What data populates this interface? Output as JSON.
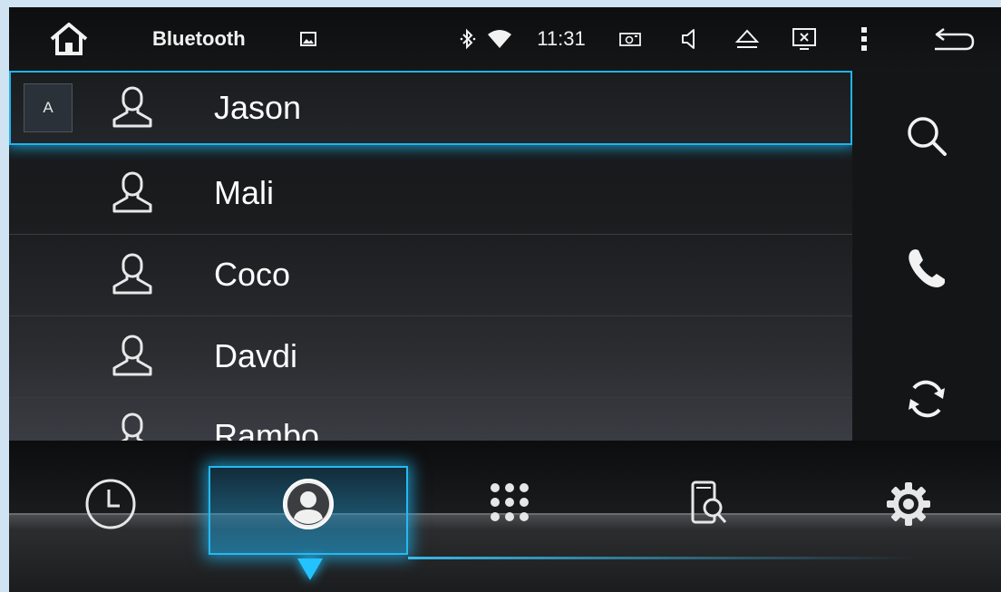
{
  "status_bar": {
    "title": "Bluetooth",
    "time": "11:31",
    "icons": [
      "home-icon",
      "image-icon",
      "bluetooth-icon",
      "wifi-icon",
      "screenshot-icon",
      "volume-icon",
      "eject-icon",
      "close-window-icon",
      "more-icon",
      "back-icon"
    ]
  },
  "contacts": {
    "index_letter": "A",
    "items": [
      {
        "name": "Jason",
        "selected": true
      },
      {
        "name": "Mali"
      },
      {
        "name": "Coco"
      },
      {
        "name": "Davdi"
      },
      {
        "name": "Rambo"
      }
    ]
  },
  "side_actions": [
    "search-icon",
    "call-icon",
    "sync-icon"
  ],
  "bottom_nav": {
    "items": [
      "call-history-icon",
      "contacts-icon",
      "dialpad-icon",
      "device-search-icon",
      "settings-icon"
    ],
    "active": "contacts-icon"
  },
  "colors": {
    "accent": "#1fb4f0",
    "background": "#141516",
    "text": "#ffffff"
  }
}
